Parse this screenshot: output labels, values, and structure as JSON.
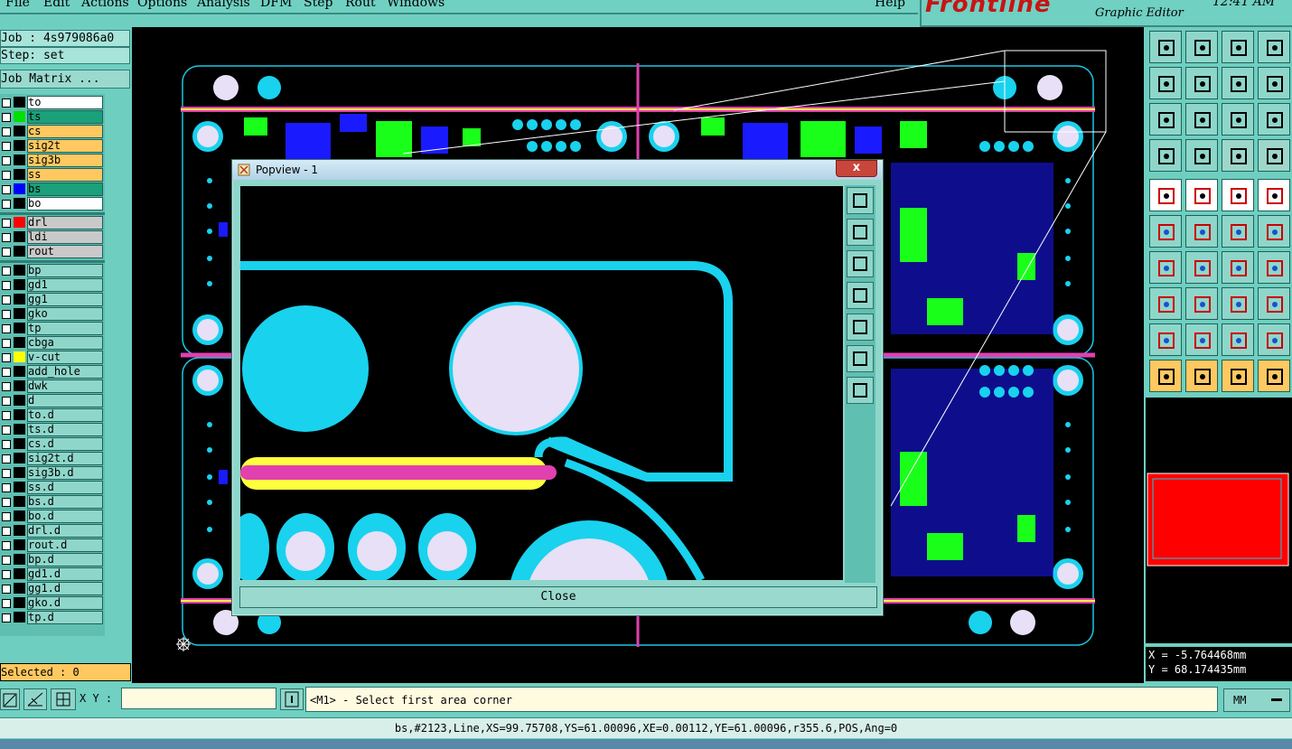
{
  "menu": {
    "items": [
      "File",
      "Edit",
      "Actions",
      "Options",
      "Analysis",
      "DFM",
      "Step",
      "Rout",
      "Windows"
    ],
    "help": "Help"
  },
  "brand": {
    "logo": "Frontline",
    "app": "Graphic Editor",
    "clock": "12:41 AM"
  },
  "job": {
    "label": "Job : 4s979086a0",
    "step": "Step: set",
    "matrix_button": "Job Matrix ..."
  },
  "layers_group1": [
    {
      "name": "to",
      "color": "#ffffff",
      "swatch": "#000000"
    },
    {
      "name": "ts",
      "color": "#1aa07a",
      "swatch": "#00e000"
    },
    {
      "name": "cs",
      "color": "#ffc860",
      "swatch": "#000000"
    },
    {
      "name": "sig2t",
      "color": "#ffc860",
      "swatch": "#000000"
    },
    {
      "name": "sig3b",
      "color": "#ffc860",
      "swatch": "#000000"
    },
    {
      "name": "ss",
      "color": "#ffc860",
      "swatch": "#000000"
    },
    {
      "name": "bs",
      "color": "#1aa07a",
      "swatch": "#0000ff"
    },
    {
      "name": "bo",
      "color": "#ffffff",
      "swatch": "#000000"
    }
  ],
  "layers_group2": [
    {
      "name": "drl",
      "color": "#c9c9c9",
      "swatch": "#ff0000"
    },
    {
      "name": "ldi",
      "color": "#c9c9c9",
      "swatch": "#000000"
    },
    {
      "name": "rout",
      "color": "#c9c9c9",
      "swatch": "#000000"
    }
  ],
  "layers_group3": [
    {
      "name": "bp",
      "swatch": "#000000"
    },
    {
      "name": "gd1",
      "swatch": "#000000"
    },
    {
      "name": "gg1",
      "swatch": "#000000"
    },
    {
      "name": "gko",
      "swatch": "#000000"
    },
    {
      "name": "tp",
      "swatch": "#000000"
    },
    {
      "name": "cbga",
      "swatch": "#000000"
    },
    {
      "name": "v-cut",
      "swatch": "#ffff00"
    },
    {
      "name": "add_hole",
      "swatch": "#000000"
    },
    {
      "name": "dwk",
      "swatch": "#000000"
    },
    {
      "name": "d",
      "swatch": "#000000"
    },
    {
      "name": "to.d",
      "swatch": "#000000"
    },
    {
      "name": "ts.d",
      "swatch": "#000000"
    },
    {
      "name": "cs.d",
      "swatch": "#000000"
    },
    {
      "name": "sig2t.d",
      "swatch": "#000000"
    },
    {
      "name": "sig3b.d",
      "swatch": "#000000"
    },
    {
      "name": "ss.d",
      "swatch": "#000000"
    },
    {
      "name": "bs.d",
      "swatch": "#000000"
    },
    {
      "name": "bo.d",
      "swatch": "#000000"
    },
    {
      "name": "drl.d",
      "swatch": "#000000"
    },
    {
      "name": "rout.d",
      "swatch": "#000000"
    },
    {
      "name": "bp.d",
      "swatch": "#000000"
    },
    {
      "name": "gd1.d",
      "swatch": "#000000"
    },
    {
      "name": "gg1.d",
      "swatch": "#000000"
    },
    {
      "name": "gko.d",
      "swatch": "#000000"
    },
    {
      "name": "tp.d",
      "swatch": "#000000"
    }
  ],
  "selected": "Selected : 0",
  "popup": {
    "title": "Popview - 1",
    "close_x": "x",
    "close_button": "Close"
  },
  "coords": {
    "x": "X = -5.764468mm",
    "y": "Y = 68.174435mm"
  },
  "cmd": {
    "xy_label": "X Y :",
    "xy_value": "",
    "prompt": "<M1> - Select first area corner",
    "units": "MM"
  },
  "status": "bs,#2123,Line,XS=99.75708,YS=61.00096,XE=0.00112,YE=61.00096,r355.6,POS,Ang=0",
  "colors": {
    "panel": "#6ecfc0",
    "board_outline": "#19c8e6",
    "pad_fill": "#19d2ee",
    "hole": "#e8e0f6",
    "trace_pink": "#e040b0",
    "trace_yellow": "#ffff40"
  }
}
